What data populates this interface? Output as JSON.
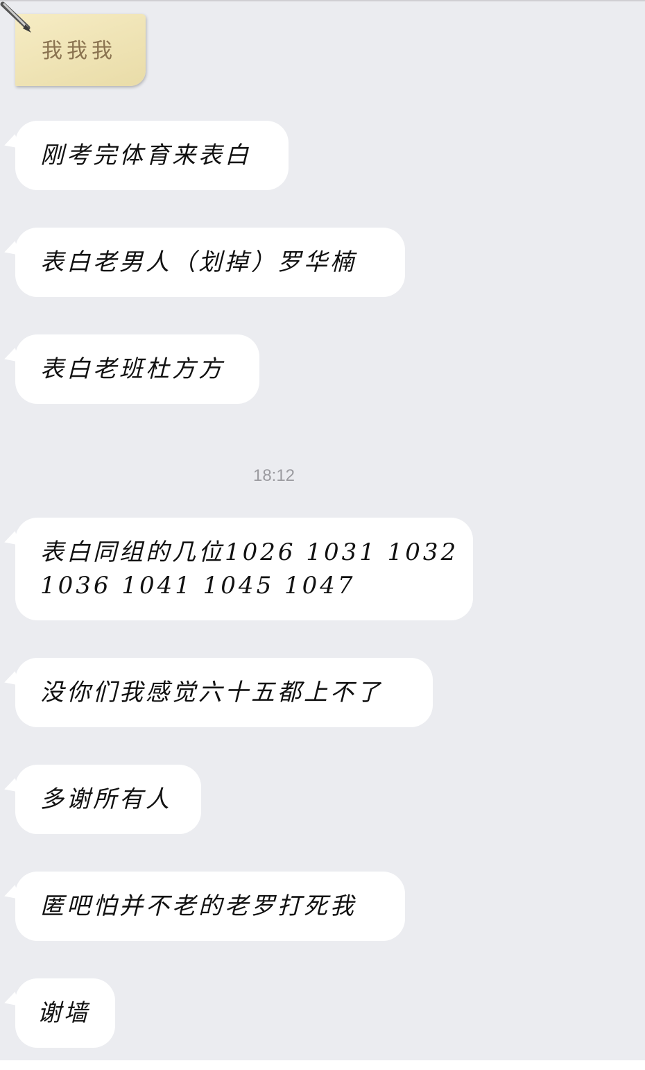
{
  "note": {
    "text": "我我我"
  },
  "messages": [
    {
      "lines": [
        "刚考完体育来表白"
      ]
    },
    {
      "lines": [
        "表白老男人（划掉）罗华楠"
      ]
    },
    {
      "lines": [
        "表白老班杜方方"
      ]
    },
    {
      "lines": [
        "表白同组的几位1026 1031 1032",
        "1036 1041 1045 1047"
      ]
    },
    {
      "lines": [
        "没你们我感觉六十五都上不了"
      ]
    },
    {
      "lines": [
        "多谢所有人"
      ]
    },
    {
      "lines": [
        "匿吧怕并不老的老罗打死我"
      ]
    },
    {
      "lines": [
        "谢墙"
      ]
    }
  ],
  "timestamp": "18:12",
  "colors": {
    "background": "#ebecf0",
    "bubble": "#ffffff",
    "text": "#111111",
    "timestamp": "#9b9ba0"
  }
}
